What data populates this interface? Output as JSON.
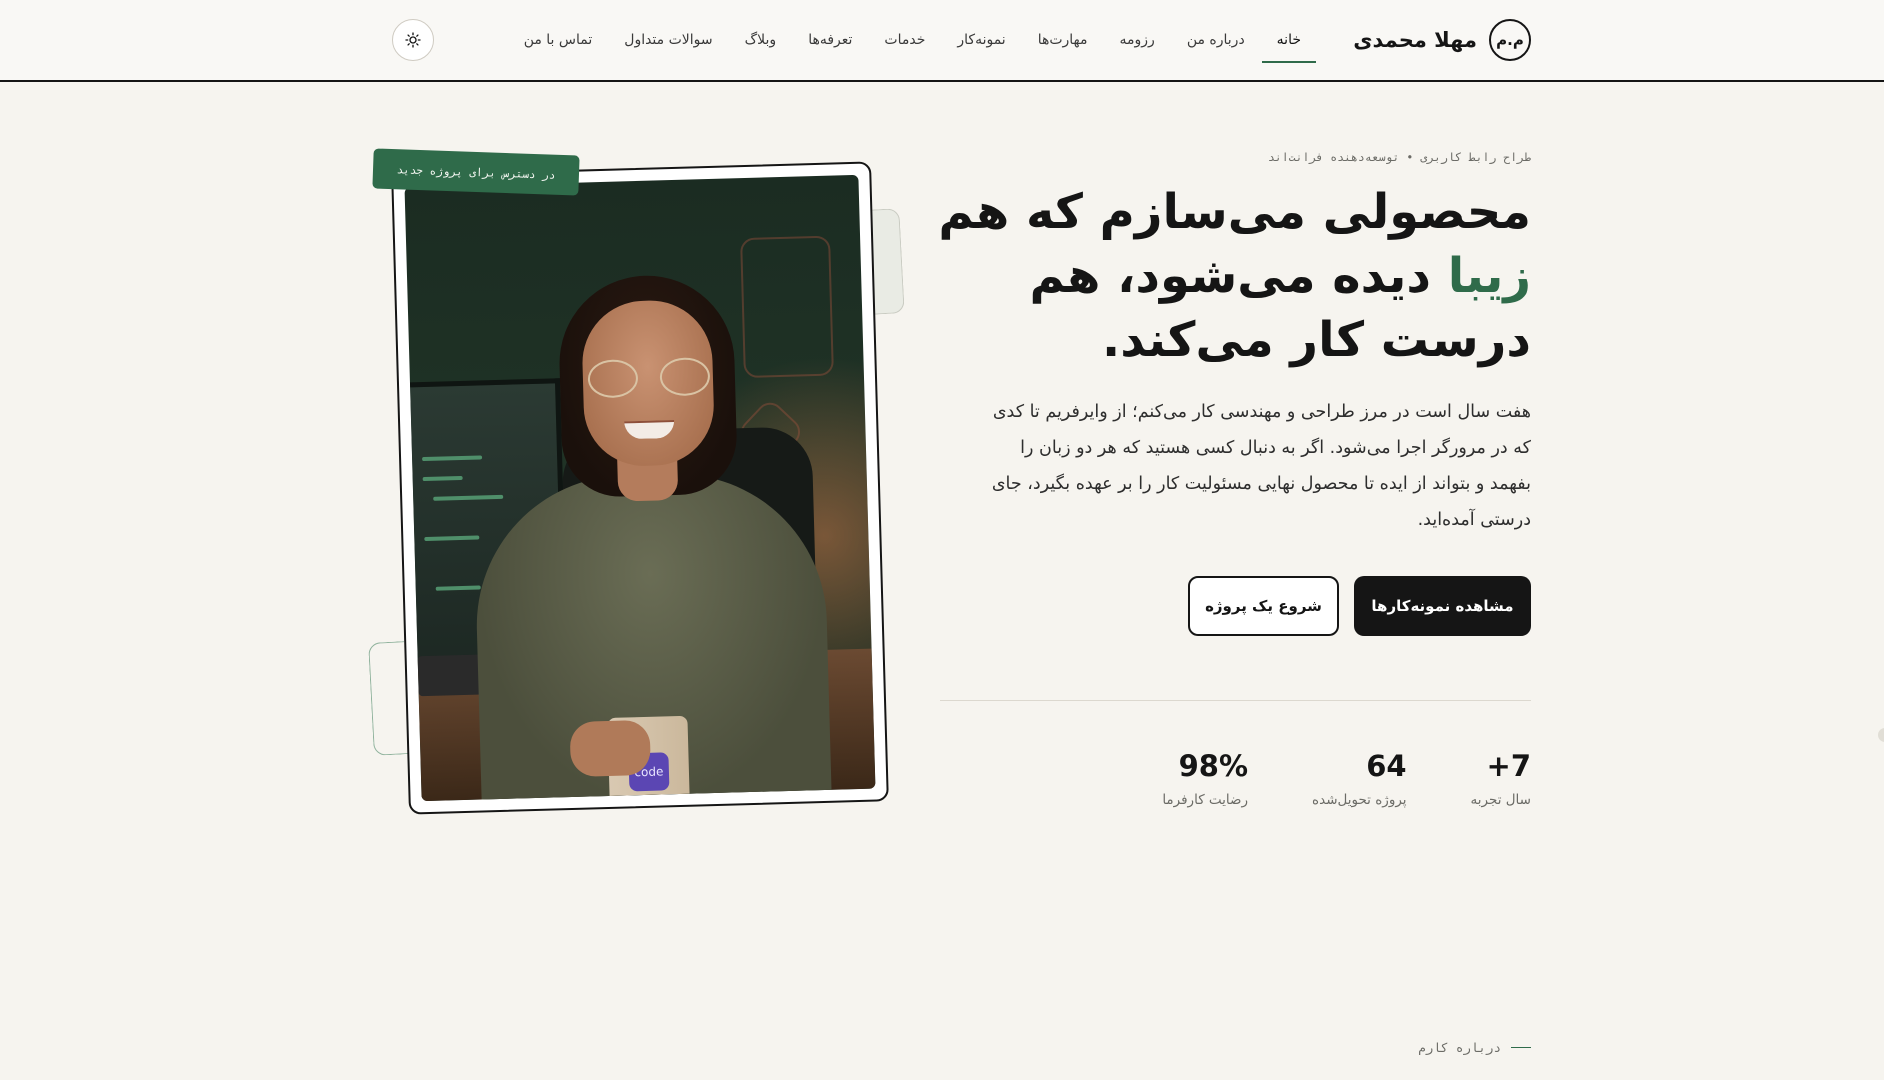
{
  "header": {
    "monogram": "م.م",
    "brand_name": "مهلا محمدی",
    "nav": [
      {
        "label": "خانه",
        "active": true
      },
      {
        "label": "درباره من"
      },
      {
        "label": "رزومه"
      },
      {
        "label": "مهارت‌ها"
      },
      {
        "label": "نمونه‌کار"
      },
      {
        "label": "خدمات"
      },
      {
        "label": "تعرفه‌ها"
      },
      {
        "label": "وبلاگ"
      },
      {
        "label": "سوالات متداول"
      },
      {
        "label": "تماس با من"
      }
    ],
    "theme_toggle_icon": "sun-icon"
  },
  "hero": {
    "eyebrow": "طراح رابط کاربری • توسعه‌دهنده فرانت‌اند",
    "headline_before": "محصولی می‌سازم که هم ",
    "headline_accent": "زیبا",
    "headline_after": " دیده می‌شود، هم درست کار می‌کند.",
    "lead": "هفت سال است در مرز طراحی و مهندسی کار می‌کنم؛ از وایرفریم تا کدی که در مرورگر اجرا می‌شود. اگر به دنبال کسی هستید که هر دو زبان را بفهمد و بتواند از ایده تا محصول نهایی مسئولیت کار را بر عهده بگیرد، جای درستی آمده‌اید.",
    "primary_button": "مشاهده نمونه‌کارها",
    "secondary_button": "شروع یک پروژه",
    "accent_color": "#2f6b4a",
    "stats": [
      {
        "value": "+7",
        "label": "سال تجربه"
      },
      {
        "value": "64",
        "label": "پروژه تحویل‌شده"
      },
      {
        "value": "98%",
        "label": "رضایت کارفرما"
      }
    ]
  },
  "photo": {
    "availability_tag": "در دسترس برای پروژه جدید",
    "mug_text": "code"
  },
  "next_section": {
    "eyebrow": "درباره کارم"
  }
}
